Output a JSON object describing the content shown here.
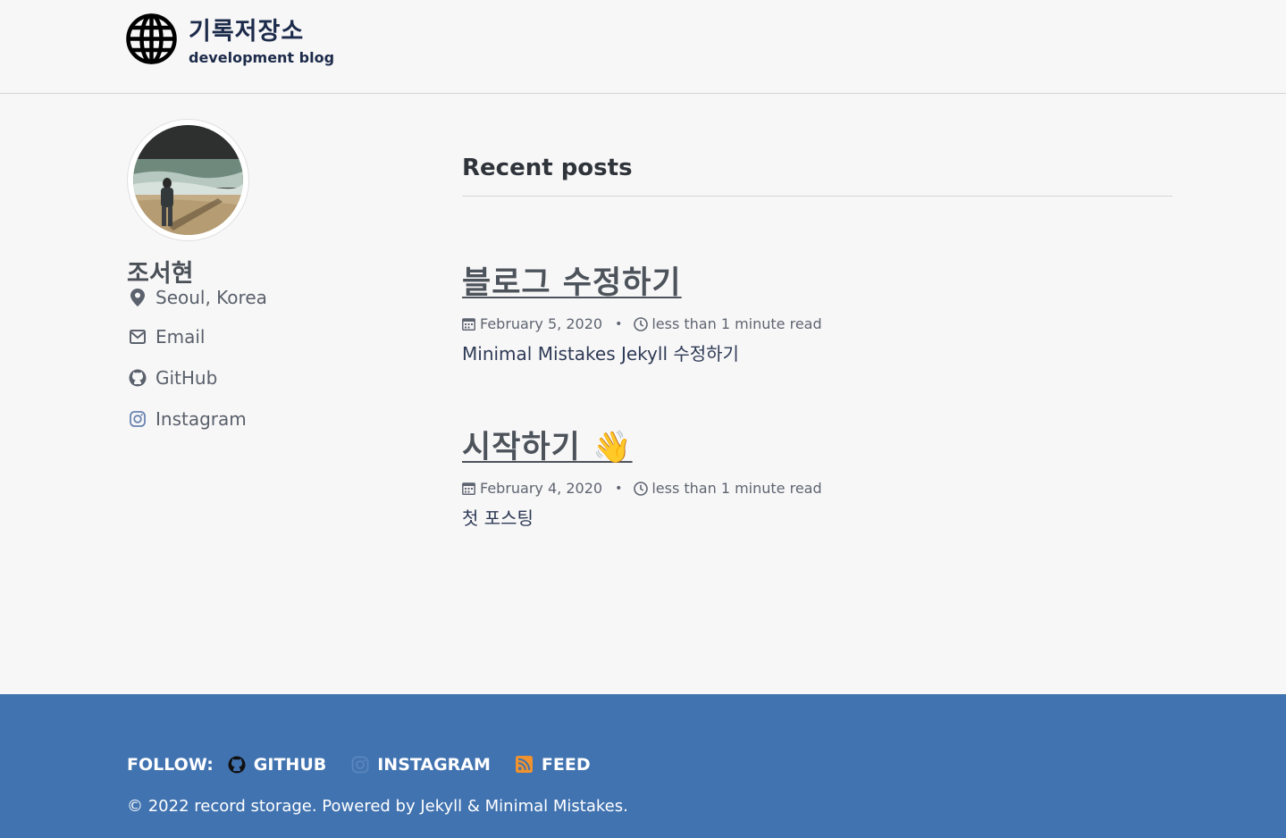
{
  "header": {
    "logo_icon": "globe-icon",
    "title": "기록저장소",
    "subtitle": "development blog"
  },
  "sidebar": {
    "avatar_alt": "person standing on beach at shoreline",
    "name": "조서현",
    "location": "Seoul, Korea",
    "links": [
      {
        "label": "Email",
        "icon": "envelope-icon"
      },
      {
        "label": "GitHub",
        "icon": "github-icon"
      },
      {
        "label": "Instagram",
        "icon": "instagram-icon"
      }
    ]
  },
  "main": {
    "heading": "Recent posts",
    "posts": [
      {
        "title": "블로그 수정하기",
        "date": "February 5, 2020",
        "read_time": "less than 1 minute read",
        "excerpt": "Minimal Mistakes Jekyll 수정하기"
      },
      {
        "title": "시작하기 👋",
        "date": "February 4, 2020",
        "read_time": "less than 1 minute read",
        "excerpt": "첫 포스팅"
      }
    ]
  },
  "footer": {
    "follow_label": "FOLLOW:",
    "links": [
      {
        "label": "GITHUB",
        "icon": "github-icon"
      },
      {
        "label": "INSTAGRAM",
        "icon": "instagram-icon"
      },
      {
        "label": "FEED",
        "icon": "rss-feed-icon"
      }
    ],
    "copyright": "© 2022 record storage. Powered by Jekyll & Minimal Mistakes."
  },
  "colors": {
    "background": "#f8f7f8",
    "title_navy": "#1c2b4a",
    "footer_blue": "#4173b0",
    "feed_orange": "#f0922d"
  }
}
